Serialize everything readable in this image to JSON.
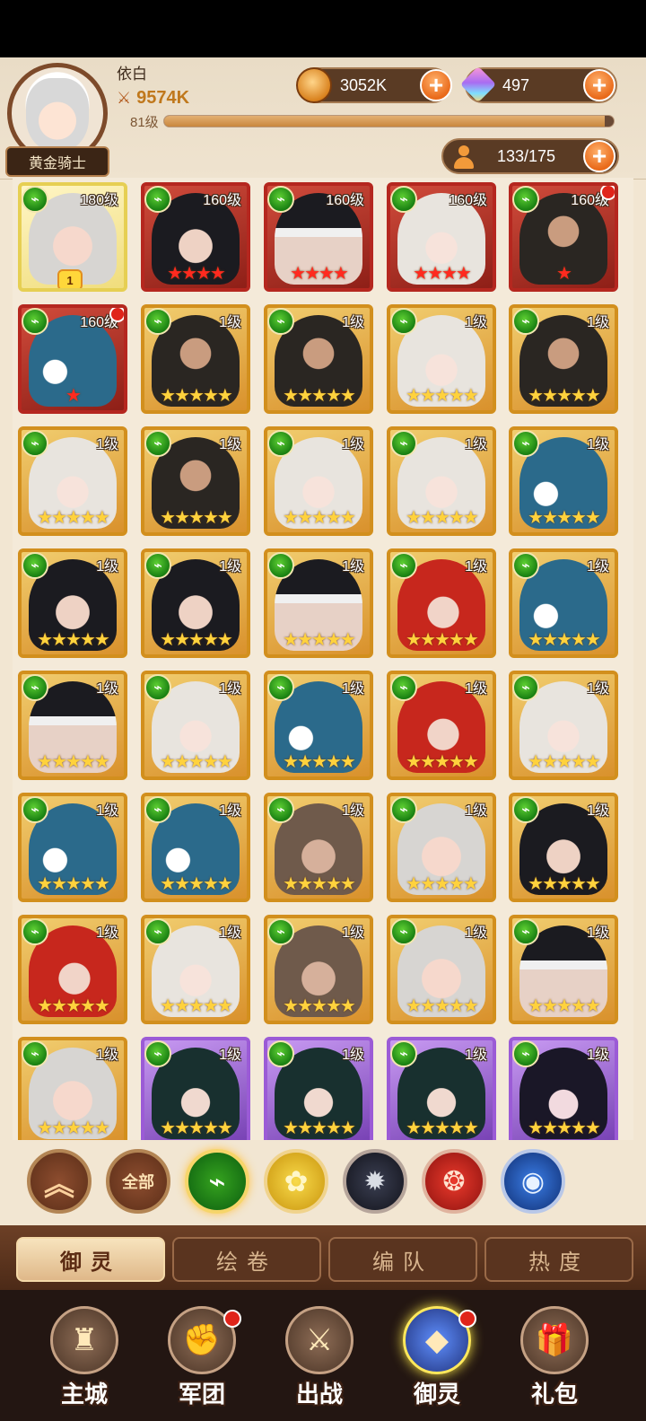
{
  "player": {
    "name": "依白",
    "power": "9574K",
    "level": "81级",
    "xp_fraction": 0.98,
    "title": "黄金骑士"
  },
  "currencies": {
    "coins": "3052K",
    "gems": "497"
  },
  "roster": "133/175",
  "heroes": [
    {
      "level": "180级",
      "frame": "yellow",
      "portrait": "silver",
      "stars": "",
      "star_color": "gold",
      "rank": "1",
      "alert": false
    },
    {
      "level": "160级",
      "frame": "red",
      "portrait": "black",
      "stars": "★★★★",
      "star_color": "red",
      "rank": "",
      "alert": false
    },
    {
      "level": "160级",
      "frame": "red",
      "portrait": "blind",
      "stars": "★★★★",
      "star_color": "red",
      "rank": "",
      "alert": false
    },
    {
      "level": "160级",
      "frame": "red",
      "portrait": "white",
      "stars": "★★★★",
      "star_color": "red",
      "rank": "",
      "alert": false
    },
    {
      "level": "160级",
      "frame": "red",
      "portrait": "beard",
      "stars": "★",
      "star_color": "red",
      "rank": "",
      "alert": true
    },
    {
      "level": "160级",
      "frame": "red",
      "portrait": "blue",
      "stars": "★",
      "star_color": "red",
      "rank": "",
      "alert": true
    },
    {
      "level": "1级",
      "frame": "gold",
      "portrait": "beard",
      "stars": "★★★★★",
      "star_color": "gold",
      "rank": "",
      "alert": false
    },
    {
      "level": "1级",
      "frame": "gold",
      "portrait": "beard",
      "stars": "★★★★★",
      "star_color": "gold",
      "rank": "",
      "alert": false
    },
    {
      "level": "1级",
      "frame": "gold",
      "portrait": "white",
      "stars": "★★★★★",
      "star_color": "gold",
      "rank": "",
      "alert": false
    },
    {
      "level": "1级",
      "frame": "gold",
      "portrait": "beard",
      "stars": "★★★★★",
      "star_color": "gold",
      "rank": "",
      "alert": false
    },
    {
      "level": "1级",
      "frame": "gold",
      "portrait": "white",
      "stars": "★★★★★",
      "star_color": "gold",
      "rank": "",
      "alert": false
    },
    {
      "level": "1级",
      "frame": "gold",
      "portrait": "beard",
      "stars": "★★★★★",
      "star_color": "gold",
      "rank": "",
      "alert": false
    },
    {
      "level": "1级",
      "frame": "gold",
      "portrait": "white",
      "stars": "★★★★★",
      "star_color": "gold",
      "rank": "",
      "alert": false
    },
    {
      "level": "1级",
      "frame": "gold",
      "portrait": "white",
      "stars": "★★★★★",
      "star_color": "gold",
      "rank": "",
      "alert": false
    },
    {
      "level": "1级",
      "frame": "gold",
      "portrait": "blue",
      "stars": "★★★★★",
      "star_color": "gold",
      "rank": "",
      "alert": false
    },
    {
      "level": "1级",
      "frame": "gold",
      "portrait": "black",
      "stars": "★★★★★",
      "star_color": "gold",
      "rank": "",
      "alert": false
    },
    {
      "level": "1级",
      "frame": "gold",
      "portrait": "black",
      "stars": "★★★★★",
      "star_color": "gold",
      "rank": "",
      "alert": false
    },
    {
      "level": "1级",
      "frame": "gold",
      "portrait": "blind",
      "stars": "★★★★★",
      "star_color": "gold",
      "rank": "",
      "alert": false
    },
    {
      "level": "1级",
      "frame": "gold",
      "portrait": "red",
      "stars": "★★★★★",
      "star_color": "gold",
      "rank": "",
      "alert": false
    },
    {
      "level": "1级",
      "frame": "gold",
      "portrait": "blue",
      "stars": "★★★★★",
      "star_color": "gold",
      "rank": "",
      "alert": false
    },
    {
      "level": "1级",
      "frame": "gold",
      "portrait": "blind",
      "stars": "★★★★★",
      "star_color": "gold",
      "rank": "",
      "alert": false
    },
    {
      "level": "1级",
      "frame": "gold",
      "portrait": "white",
      "stars": "★★★★★",
      "star_color": "gold",
      "rank": "",
      "alert": false
    },
    {
      "level": "1级",
      "frame": "gold",
      "portrait": "blue",
      "stars": "★★★★★",
      "star_color": "gold",
      "rank": "",
      "alert": false
    },
    {
      "level": "1级",
      "frame": "gold",
      "portrait": "red",
      "stars": "★★★★★",
      "star_color": "gold",
      "rank": "",
      "alert": false
    },
    {
      "level": "1级",
      "frame": "gold",
      "portrait": "white",
      "stars": "★★★★★",
      "star_color": "gold",
      "rank": "",
      "alert": false
    },
    {
      "level": "1级",
      "frame": "gold",
      "portrait": "blue",
      "stars": "★★★★★",
      "star_color": "gold",
      "rank": "",
      "alert": false
    },
    {
      "level": "1级",
      "frame": "gold",
      "portrait": "blue",
      "stars": "★★★★★",
      "star_color": "gold",
      "rank": "",
      "alert": false
    },
    {
      "level": "1级",
      "frame": "gold",
      "portrait": "brown",
      "stars": "★★★★★",
      "star_color": "gold",
      "rank": "",
      "alert": false
    },
    {
      "level": "1级",
      "frame": "gold",
      "portrait": "silver",
      "stars": "★★★★★",
      "star_color": "gold",
      "rank": "",
      "alert": false
    },
    {
      "level": "1级",
      "frame": "gold",
      "portrait": "black",
      "stars": "★★★★★",
      "star_color": "gold",
      "rank": "",
      "alert": false
    },
    {
      "level": "1级",
      "frame": "gold",
      "portrait": "red",
      "stars": "★★★★★",
      "star_color": "gold",
      "rank": "",
      "alert": false
    },
    {
      "level": "1级",
      "frame": "gold",
      "portrait": "white",
      "stars": "★★★★★",
      "star_color": "gold",
      "rank": "",
      "alert": false
    },
    {
      "level": "1级",
      "frame": "gold",
      "portrait": "brown",
      "stars": "★★★★★",
      "star_color": "gold",
      "rank": "",
      "alert": false
    },
    {
      "level": "1级",
      "frame": "gold",
      "portrait": "silver",
      "stars": "★★★★★",
      "star_color": "gold",
      "rank": "",
      "alert": false
    },
    {
      "level": "1级",
      "frame": "gold",
      "portrait": "blind",
      "stars": "★★★★★",
      "star_color": "gold",
      "rank": "",
      "alert": false
    },
    {
      "level": "1级",
      "frame": "gold",
      "portrait": "silver",
      "stars": "★★★★★",
      "star_color": "gold",
      "rank": "",
      "alert": false
    },
    {
      "level": "1级",
      "frame": "purple",
      "portrait": "teal",
      "stars": "★★★★★",
      "star_color": "gold",
      "rank": "",
      "alert": false
    },
    {
      "level": "1级",
      "frame": "purple",
      "portrait": "teal",
      "stars": "★★★★★",
      "star_color": "gold",
      "rank": "",
      "alert": false
    },
    {
      "level": "1级",
      "frame": "purple",
      "portrait": "teal",
      "stars": "★★★★★",
      "star_color": "gold",
      "rank": "",
      "alert": false
    },
    {
      "level": "1级",
      "frame": "purple",
      "portrait": "violet",
      "stars": "★★★★★",
      "star_color": "gold",
      "rank": "",
      "alert": false
    }
  ],
  "filters": [
    {
      "name": "collapse",
      "glyph": "︽",
      "class": "f-collapse"
    },
    {
      "name": "all",
      "glyph": "全部",
      "class": "f-all"
    },
    {
      "name": "nature",
      "glyph": "⌁",
      "class": "f-green"
    },
    {
      "name": "light",
      "glyph": "✿",
      "class": "f-yellow"
    },
    {
      "name": "dark",
      "glyph": "✹",
      "class": "f-dark"
    },
    {
      "name": "fire",
      "glyph": "❂",
      "class": "f-red"
    },
    {
      "name": "water",
      "glyph": "◉",
      "class": "f-blue"
    }
  ],
  "tabs": [
    {
      "label": "御灵",
      "active": true
    },
    {
      "label": "绘卷",
      "active": false
    },
    {
      "label": "编队",
      "active": false
    },
    {
      "label": "热度",
      "active": false
    }
  ],
  "nav": [
    {
      "label": "主城",
      "icon": "♜",
      "active": false,
      "badge": false
    },
    {
      "label": "军团",
      "icon": "✊",
      "active": false,
      "badge": true
    },
    {
      "label": "出战",
      "icon": "⚔",
      "active": false,
      "badge": false
    },
    {
      "label": "御灵",
      "icon": "◆",
      "active": true,
      "badge": true
    },
    {
      "label": "礼包",
      "icon": "🎁",
      "active": false,
      "badge": false
    }
  ],
  "colors": {
    "accent_orange": "#e96a1a",
    "frame_gold": "#d28f1d",
    "frame_red": "#b5271f",
    "frame_purple": "#9b5bd6",
    "badge_red": "#e0241a"
  }
}
